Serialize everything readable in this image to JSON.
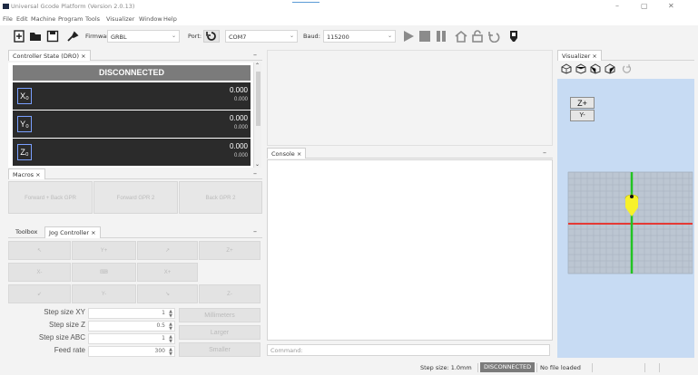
{
  "window": {
    "title": "Universal Gcode Platform (Version 2.0.13)",
    "controls": {
      "minimize": "–",
      "maximize": "▢",
      "close": "✕"
    }
  },
  "menu": [
    "File",
    "Edit",
    "Machine",
    "Program",
    "Tools",
    "Visualizer",
    "Window",
    "Help"
  ],
  "toolbar": {
    "firmware_label": "Firmware:",
    "firmware_value": "GRBL",
    "port_label": "Port:",
    "port_value": "COM7",
    "baud_label": "Baud:",
    "baud_value": "115200"
  },
  "dro": {
    "tab": "Controller State (DRO)",
    "tab_close": "×",
    "state": "DISCONNECTED",
    "axes": [
      {
        "label": "X₀",
        "work": "0.000",
        "machine": "0.000"
      },
      {
        "label": "Y₀",
        "work": "0.000",
        "machine": "0.000"
      },
      {
        "label": "Z₀",
        "work": "0.000",
        "machine": "0.000"
      }
    ]
  },
  "macros": {
    "tab": "Macros",
    "tab_close": "×",
    "buttons": [
      "Forward + Back GPR",
      "Forward GPR 2",
      "Back GPR 2"
    ]
  },
  "jog": {
    "tabs": [
      "Toolbox",
      "Jog Controller"
    ],
    "tab_close": "×",
    "buttons": [
      "↖",
      "Y+",
      "↗",
      "Z+",
      "X-",
      "⌨",
      "X+",
      "↙",
      "Y-",
      "↘",
      "Z-"
    ],
    "step_xy_label": "Step size XY",
    "step_xy_value": "1",
    "step_z_label": "Step size Z",
    "step_z_value": "0.5",
    "step_abc_label": "Step size ABC",
    "step_abc_value": "1",
    "feed_label": "Feed rate",
    "feed_value": "300",
    "units_btn": "Millimeters",
    "larger_btn": "Larger",
    "smaller_btn": "Smaller"
  },
  "console": {
    "tab": "Console",
    "tab_close": "×",
    "command_label": "Command:"
  },
  "visualizer": {
    "tab": "Visualizer",
    "tab_close": "×",
    "zplus": "Z+",
    "yminus": "Y-"
  },
  "status": {
    "step_size": "Step size: 1.0mm",
    "state": "DISCONNECTED",
    "file": "No file loaded"
  },
  "colors": {
    "dro_bg": "#2b2b2b",
    "state_bg": "#7b7b7b",
    "viz_bg": "#c7dbf3",
    "axis_x": "#e53935",
    "axis_y": "#22c322",
    "tool": "#f7f12a"
  }
}
